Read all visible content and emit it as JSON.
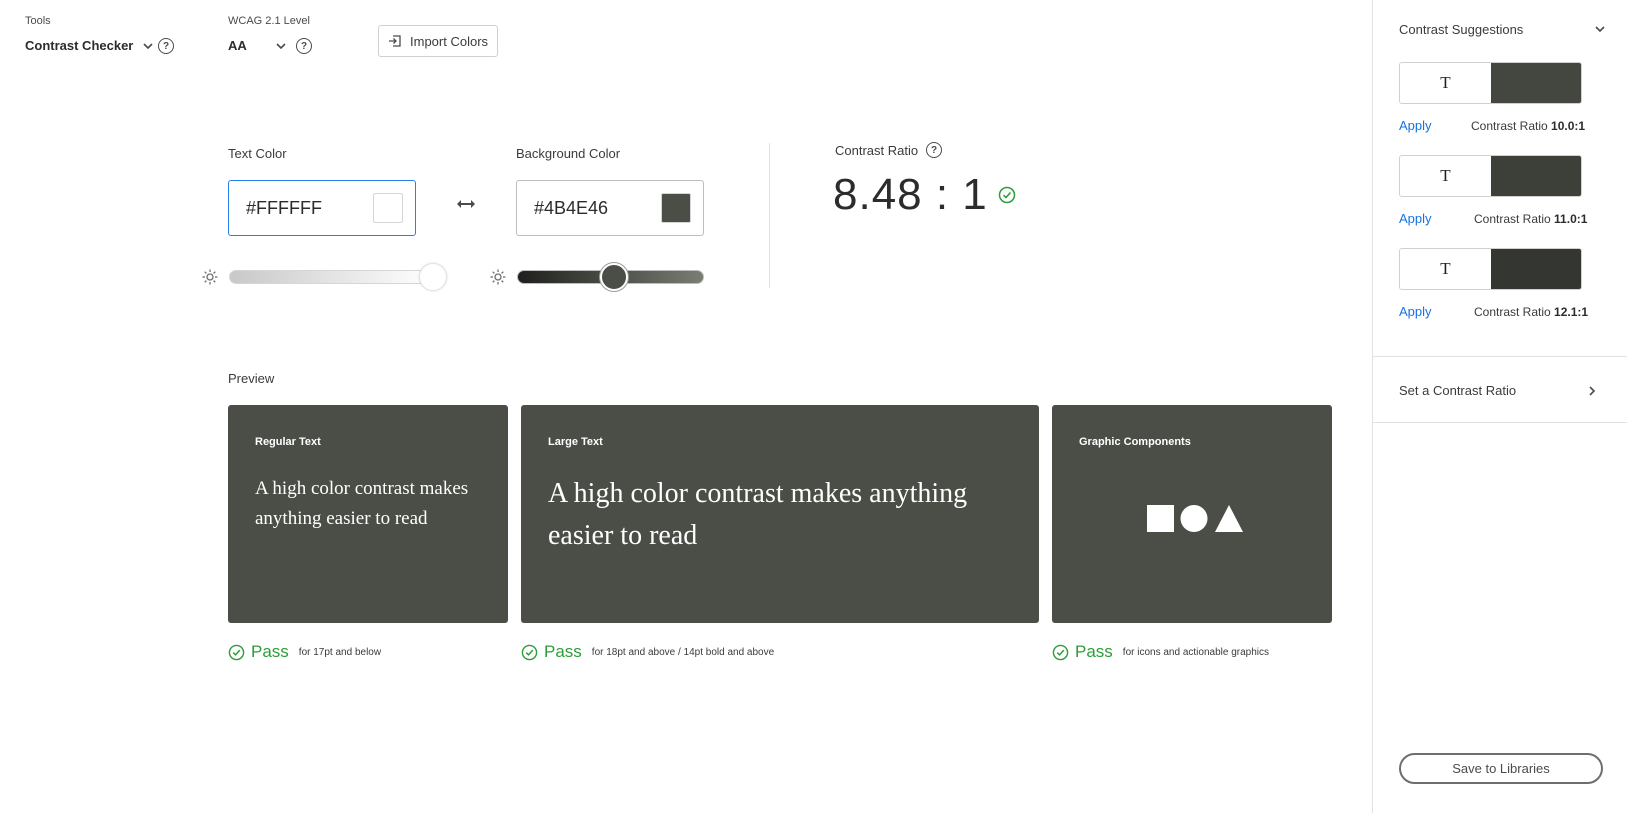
{
  "tools": {
    "label": "Tools",
    "value": "Contrast Checker"
  },
  "wcag": {
    "label": "WCAG 2.1 Level",
    "value": "AA"
  },
  "import_button": "Import Colors",
  "text_color": {
    "label": "Text Color",
    "value": "#FFFFFF",
    "swatch": "#FFFFFF",
    "brightness": 1.0
  },
  "background_color": {
    "label": "Background Color",
    "value": "#4B4E46",
    "swatch": "#4B4E46",
    "brightness": 0.52
  },
  "contrast": {
    "label": "Contrast Ratio",
    "value": "8.48 : 1"
  },
  "preview": {
    "label": "Preview",
    "cards": [
      {
        "title": "Regular Text",
        "text": "A high color contrast makes anything easier to read",
        "pass": "Pass",
        "desc": "for 17pt and below"
      },
      {
        "title": "Large Text",
        "text": "A high color contrast makes anything easier to read",
        "pass": "Pass",
        "desc": "for 18pt and above / 14pt bold and above"
      },
      {
        "title": "Graphic Components",
        "pass": "Pass",
        "desc": "for icons and actionable graphics"
      }
    ]
  },
  "suggestions": {
    "title": "Contrast Suggestions",
    "items": [
      {
        "glyph": "T",
        "apply": "Apply",
        "label": "Contrast Ratio",
        "ratio": "10.0:1",
        "color": "#444640"
      },
      {
        "glyph": "T",
        "apply": "Apply",
        "label": "Contrast Ratio",
        "ratio": "11.0:1",
        "color": "#3d3f39"
      },
      {
        "glyph": "T",
        "apply": "Apply",
        "label": "Contrast Ratio",
        "ratio": "12.1:1",
        "color": "#343632"
      }
    ]
  },
  "set_ratio": "Set a Contrast Ratio",
  "save_button": "Save to Libraries",
  "colors": {
    "accent": "#2680eb",
    "pass": "#2d9d38",
    "link": "#1473e6",
    "card_bg": "#4B4E46"
  }
}
